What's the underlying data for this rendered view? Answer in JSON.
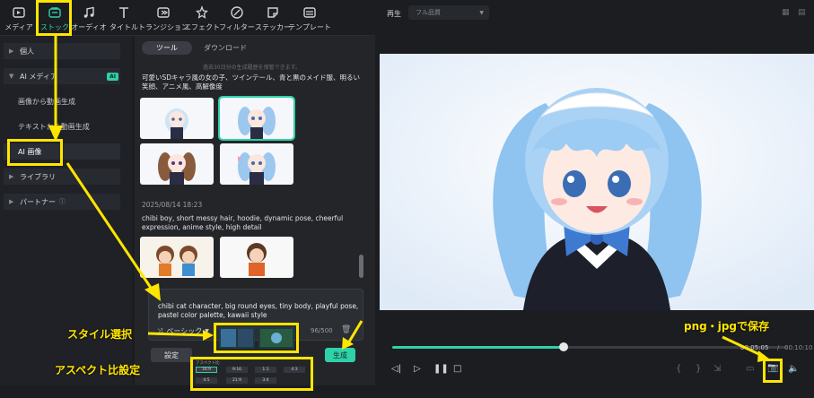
{
  "toolbar": {
    "items": [
      {
        "label": "メディア",
        "icon": "media-icon"
      },
      {
        "label": "ストック",
        "icon": "stock-icon"
      },
      {
        "label": "オーディオ",
        "icon": "audio-icon"
      },
      {
        "label": "タイトル",
        "icon": "title-icon"
      },
      {
        "label": "トランジション",
        "icon": "transition-icon"
      },
      {
        "label": "エフェクト",
        "icon": "effect-icon"
      },
      {
        "label": "フィルター",
        "icon": "filter-icon"
      },
      {
        "label": "ステッカー",
        "icon": "sticker-icon"
      },
      {
        "label": "テンプレート",
        "icon": "template-icon"
      }
    ]
  },
  "sidebar": {
    "personal": "個人",
    "ai_media": "AI メディア",
    "ai_badge": "AI",
    "image_to_video": "画像から動画生成",
    "text_to_video": "テキストから動画生成",
    "ai_image": "AI 画像",
    "library": "ライブラリ",
    "partner": "パートナー"
  },
  "content": {
    "tab_tools": "ツール",
    "tab_download": "ダウンロード",
    "faded_notice": "過去30日分の生成履歴を保管できます。",
    "group1_prompt": "可愛いSDキャラ風の女の子、ツインテール、青と黒のメイド服、明るい笑顔、アニメ風、高解像度",
    "group2_date": "2025/08/14 18:23",
    "group2_prompt": "chibi boy, short messy hair, hoodie, dynamic pose, cheerful expression, anime style, high detail"
  },
  "prompt": {
    "text": "chibi cat character, big round eyes, tiny body, playful pose, pastel color palette, kawaii style",
    "style_value": "ベーシック",
    "counter": "96/500",
    "settings_button": "設定",
    "generate_button": "生成",
    "aspect_title": "アスペクト比",
    "aspect_options": [
      "16:9",
      "9:16",
      "1:1",
      "4:3",
      "4:5",
      "21:9",
      "3:4"
    ]
  },
  "preview": {
    "tab_label": "再生",
    "quality": "フル品質",
    "time_current": "00:05:05",
    "time_separator": "/",
    "time_total": "00:10:10"
  },
  "annotations": {
    "style_select": "スタイル選択",
    "aspect_setting": "アスペクト比設定",
    "save_format": "png・jpgで保存"
  },
  "colors": {
    "accent": "#2fd1a8",
    "annotation": "#ffe500",
    "hair": "#8fc3f0",
    "outfit": "#1d1f2a"
  }
}
